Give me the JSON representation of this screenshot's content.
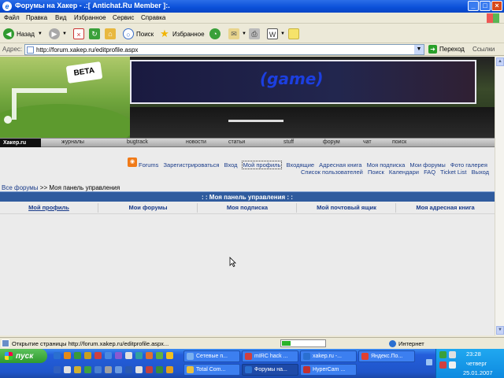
{
  "window": {
    "title": "Форумы на Хакер - .:[ Antichat.Ru Member ]:."
  },
  "menu": [
    "Файл",
    "Правка",
    "Вид",
    "Избранное",
    "Сервис",
    "Справка"
  ],
  "toolbar": {
    "back_label": "Назад",
    "search_label": "Поиск",
    "favorites_label": "Избранное"
  },
  "address": {
    "label": "Адрес:",
    "url": "http://forum.xakep.ru/editprofile.aspx",
    "go_label": "Переход",
    "links_label": "Ссылки"
  },
  "banner": {
    "beta": "BETA",
    "ad_text": "(game)"
  },
  "site_nav": {
    "logo": "Хакер.ru",
    "items": [
      "журналы",
      "bugtrack",
      "новости",
      "статьи",
      "stuff",
      "форум",
      "чат",
      "поиск"
    ]
  },
  "forum_links": {
    "row1": [
      "Forums",
      "Зарегистрироваться",
      "Вход",
      "Мой профиль",
      "Входящие",
      "Адресная книга",
      "Моя подписка",
      "Мои форумы",
      "Фото галерея"
    ],
    "row2": [
      "Список пользователей",
      "Поиск",
      "Календари",
      "FAQ",
      "Ticket List",
      "Выход"
    ]
  },
  "breadcrumb": {
    "root": "Все форумы",
    "separator": ">>",
    "current": "Моя панель управления"
  },
  "panel": {
    "title": ": : Моя панель управления : :",
    "tabs": [
      "Мой профиль",
      "Мои форумы",
      "Моя подписка",
      "Мой почтовый ящик",
      "Моя адресная книга"
    ]
  },
  "status": {
    "text": "Открытие страницы http://forum.xakep.ru/editprofile.aspx...",
    "progress": 0.2,
    "zone": "Интернет"
  },
  "taskbar": {
    "start": "пуск",
    "row1": [
      "Сетевые п...",
      "mIRC hack ...",
      "xakep.ru -...",
      "Яндекс.По..."
    ],
    "row2": [
      "Total Com...",
      "Форумы на...",
      "HyperCam ..."
    ],
    "active": "Форумы на...",
    "time": "23:28",
    "day": "четверг",
    "date": "25.01.2007"
  }
}
